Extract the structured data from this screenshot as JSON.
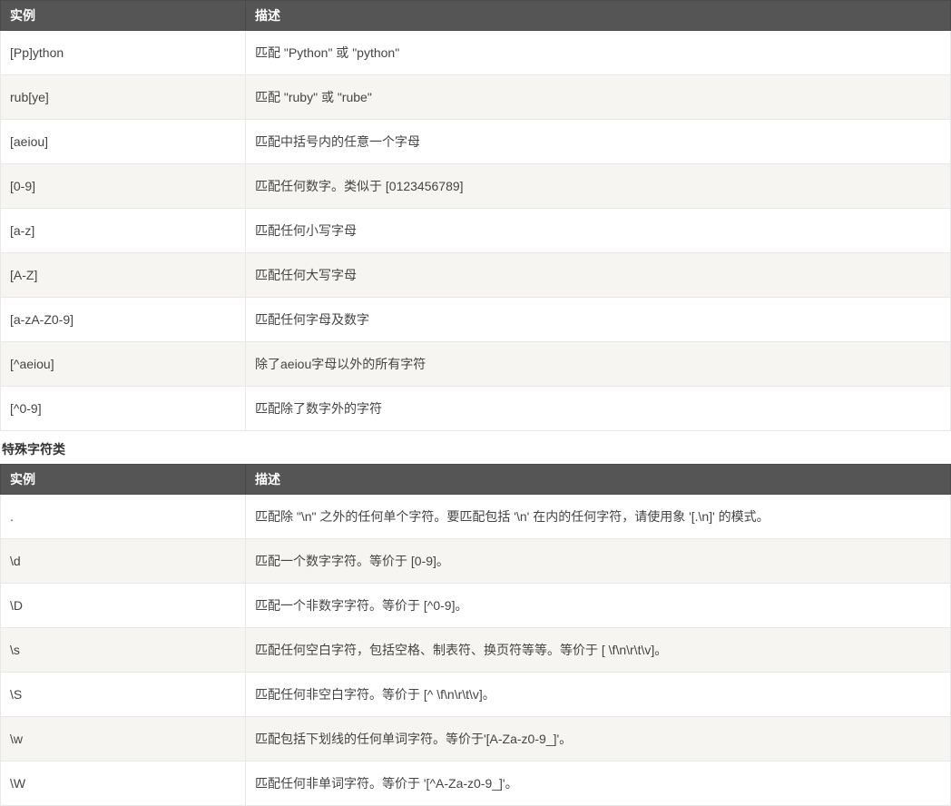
{
  "table1": {
    "headers": {
      "example": "实例",
      "description": "描述"
    },
    "rows": [
      {
        "example": "[Pp]ython",
        "description": "匹配 \"Python\" 或 \"python\""
      },
      {
        "example": "rub[ye]",
        "description": "匹配 \"ruby\" 或 \"rube\""
      },
      {
        "example": "[aeiou]",
        "description": "匹配中括号内的任意一个字母"
      },
      {
        "example": "[0-9]",
        "description": "匹配任何数字。类似于 [0123456789]"
      },
      {
        "example": "[a-z]",
        "description": "匹配任何小写字母"
      },
      {
        "example": "[A-Z]",
        "description": "匹配任何大写字母"
      },
      {
        "example": "[a-zA-Z0-9]",
        "description": "匹配任何字母及数字"
      },
      {
        "example": "[^aeiou]",
        "description": "除了aeiou字母以外的所有字符"
      },
      {
        "example": "[^0-9]",
        "description": "匹配除了数字外的字符"
      }
    ]
  },
  "section2_heading": "特殊字符类",
  "table2": {
    "headers": {
      "example": "实例",
      "description": "描述"
    },
    "rows": [
      {
        "example": ".",
        "description": "匹配除 \"\\n\" 之外的任何单个字符。要匹配包括 '\\n' 在内的任何字符，请使用象 '[.\\n]' 的模式。"
      },
      {
        "example": "\\d",
        "description": "匹配一个数字字符。等价于 [0-9]。"
      },
      {
        "example": "\\D",
        "description": "匹配一个非数字字符。等价于 [^0-9]。"
      },
      {
        "example": "\\s",
        "description": "匹配任何空白字符，包括空格、制表符、换页符等等。等价于 [ \\f\\n\\r\\t\\v]。"
      },
      {
        "example": "\\S",
        "description": "匹配任何非空白字符。等价于 [^ \\f\\n\\r\\t\\v]。"
      },
      {
        "example": "\\w",
        "description": "匹配包括下划线的任何单词字符。等价于'[A-Za-z0-9_]'。"
      },
      {
        "example": "\\W",
        "description": "匹配任何非单词字符。等价于 '[^A-Za-z0-9_]'。"
      }
    ]
  }
}
